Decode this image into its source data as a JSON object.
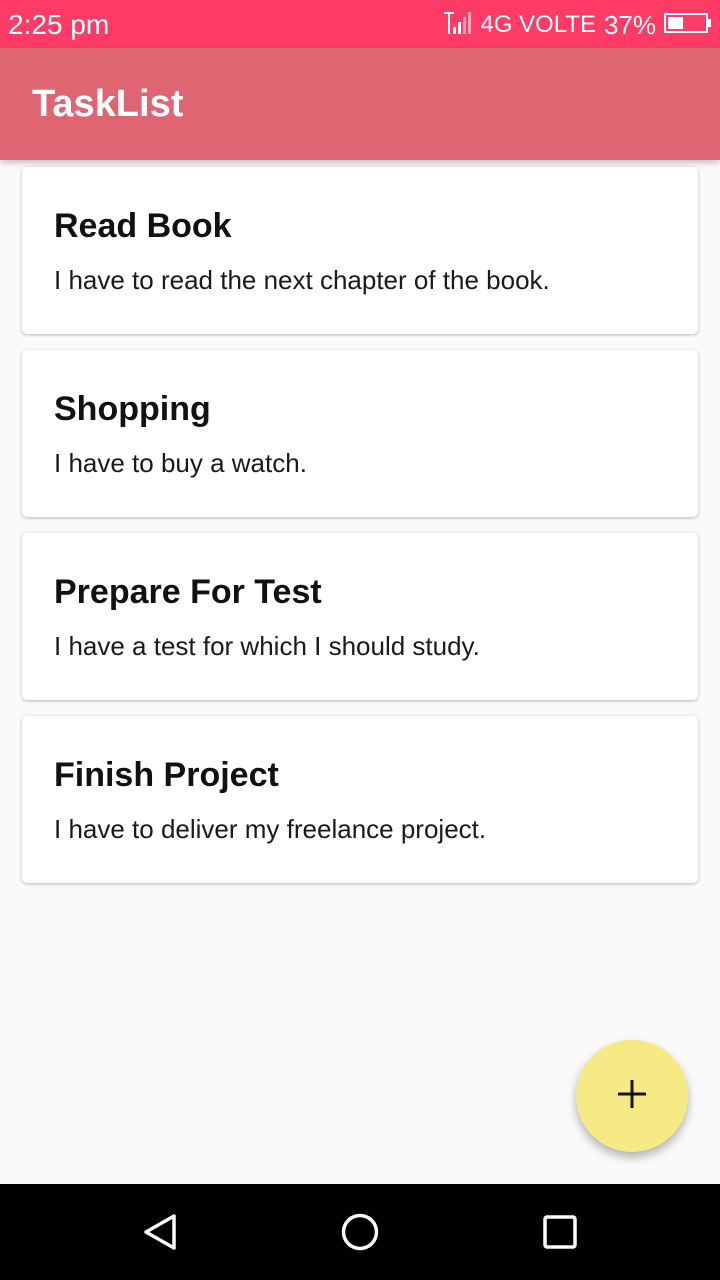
{
  "status_bar": {
    "time": "2:25 pm",
    "network": "4G VOLTE",
    "battery": "37%",
    "signal_icon": "signal-icon",
    "battery_icon": "battery-icon",
    "color": "#ff3b66"
  },
  "app_bar": {
    "title": "TaskList",
    "color": "#e06572"
  },
  "tasks": [
    {
      "title": "Read Book",
      "description": "I have to read the next chapter of the book."
    },
    {
      "title": "Shopping",
      "description": "I have to buy a watch."
    },
    {
      "title": "Prepare For Test",
      "description": "I have a test for which I should study."
    },
    {
      "title": "Finish Project",
      "description": "I have to deliver my freelance project."
    }
  ],
  "fab": {
    "icon": "plus-icon",
    "color": "#f5ea84"
  },
  "nav_bar": {
    "back_icon": "back-triangle-icon",
    "home_icon": "home-circle-icon",
    "recents_icon": "recents-square-icon"
  }
}
